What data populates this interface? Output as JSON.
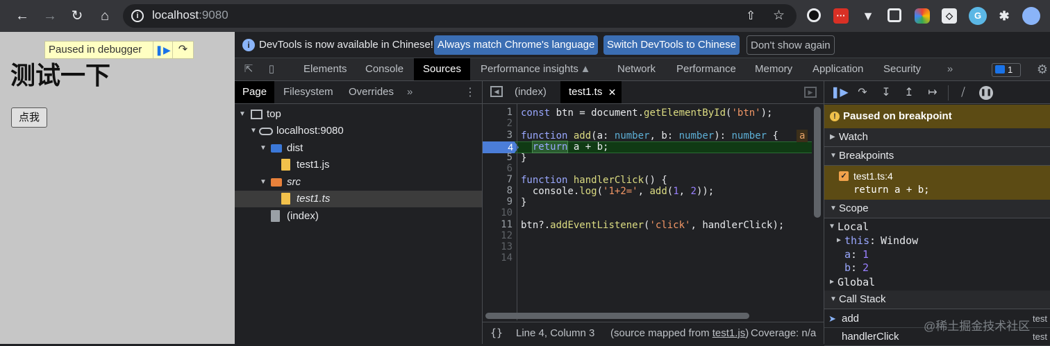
{
  "browser": {
    "url_host": "localhost",
    "url_port": ":9080"
  },
  "page": {
    "paused_label": "Paused in debugger",
    "heading": "测试一下",
    "button_label": "点我"
  },
  "infobar": {
    "text": "DevTools is now available in Chinese!",
    "btn_match": "Always match Chrome's language",
    "btn_switch": "Switch DevTools to Chinese",
    "btn_dismiss": "Don't show again"
  },
  "tabs": [
    "Elements",
    "Console",
    "Sources",
    "Performance insights",
    "Network",
    "Performance",
    "Memory",
    "Application",
    "Security"
  ],
  "issues_count": "1",
  "navigator": {
    "tabs": [
      "Page",
      "Filesystem",
      "Overrides"
    ],
    "tree": {
      "top": "top",
      "host": "localhost:9080",
      "dist": "dist",
      "dist_file": "test1.js",
      "src": "src",
      "src_file": "test1.ts",
      "index": "(index)"
    }
  },
  "editor": {
    "tabs": [
      "(index)",
      "test1.ts"
    ],
    "line_numbers": [
      "1",
      "2",
      "3",
      "4",
      "5",
      "6",
      "7",
      "8",
      "9",
      "10",
      "11",
      "12",
      "13",
      "14"
    ],
    "inline_value": "a",
    "status": {
      "position": "Line 4, Column 3",
      "mapped_prefix": "(source mapped from ",
      "mapped_link": "test1.js",
      "mapped_suffix": ")",
      "coverage": "Coverage: n/a"
    }
  },
  "debugger": {
    "paused_text": "Paused on breakpoint",
    "sections": {
      "watch": "Watch",
      "breakpoints": "Breakpoints",
      "scope": "Scope",
      "call_stack": "Call Stack"
    },
    "breakpoint": {
      "location": "test1.ts:4",
      "code": "return a + b;"
    },
    "scope": {
      "local": "Local",
      "this_key": "this",
      "this_val": "Window",
      "a_key": "a",
      "a_val": "1",
      "b_key": "b",
      "b_val": "2",
      "global": "Global"
    },
    "call_stack": [
      {
        "fn": "add",
        "file": "test"
      },
      {
        "fn": "handlerClick",
        "file": "test"
      }
    ]
  },
  "watermark": "@稀土掘金技术社区"
}
